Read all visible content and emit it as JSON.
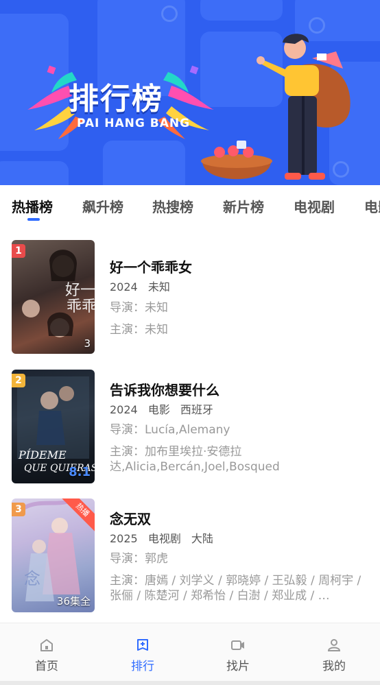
{
  "banner": {
    "title": "排行榜",
    "subtitle": "PAI HANG BANG"
  },
  "tabs": [
    {
      "label": "热播榜",
      "active": true
    },
    {
      "label": "飙升榜",
      "active": false
    },
    {
      "label": "热搜榜",
      "active": false
    },
    {
      "label": "新片榜",
      "active": false
    },
    {
      "label": "电视剧",
      "active": false
    },
    {
      "label": "电影",
      "active": false
    }
  ],
  "items": [
    {
      "rank": "1",
      "rank_color": "#e94b4b",
      "title": "好一个乖乖女",
      "year": "2024",
      "tags": [
        "未知"
      ],
      "director": "导演：未知",
      "cast": "主演：未知",
      "episodes": "3",
      "hot": false
    },
    {
      "rank": "2",
      "rank_color": "#f2b43a",
      "title": "告诉我你想要什么",
      "year": "2024",
      "tags": [
        "电影",
        "西班牙"
      ],
      "director": "导演：Lucía,Alemany",
      "cast": "主演：加布里埃拉·安德拉达,Alicia,Bercán,Joel,Bosqued",
      "episodes": "8.1",
      "hot": false
    },
    {
      "rank": "3",
      "rank_color": "#f09a4c",
      "title": "念无双",
      "year": "2025",
      "tags": [
        "电视剧",
        "大陆"
      ],
      "director": "导演：郭虎",
      "cast": "主演：唐嫣 / 刘学义 / 郭晓婷 / 王弘毅 / 周柯宇 / 张俪 / 陈楚河 / 郑希怡 / 白澍 / 郑业成 / …",
      "episodes": "36集全",
      "hot": true,
      "hot_label": "热播"
    }
  ],
  "bottom_nav": [
    {
      "label": "首页",
      "icon": "home-icon",
      "active": false
    },
    {
      "label": "排行",
      "icon": "ranking-icon",
      "active": true
    },
    {
      "label": "找片",
      "icon": "video-camera-icon",
      "active": false
    },
    {
      "label": "我的",
      "icon": "user-icon",
      "active": false
    }
  ],
  "colors": {
    "accent": "#2f6bff",
    "banner_bg": "#2f5ff0"
  }
}
